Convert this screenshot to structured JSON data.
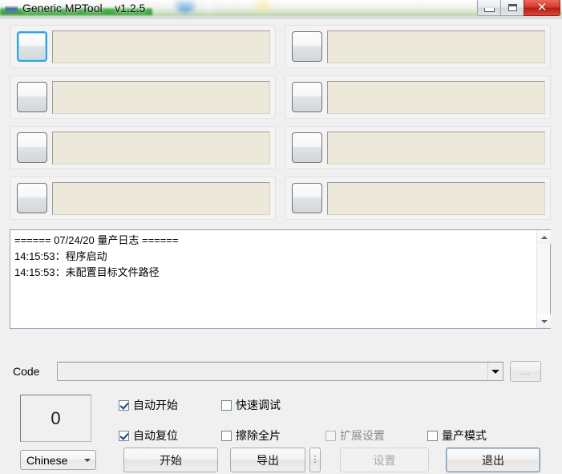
{
  "window": {
    "title": "Generic MPTool    v1.2.5",
    "app_name": "Generic MPTool",
    "version": "v1.2.5",
    "icon": "app-icon",
    "controls": {
      "minimize": "minimize-icon",
      "maximize": "maximize-icon",
      "close": "✕"
    }
  },
  "slots": [
    {
      "id": 1,
      "button_label": "",
      "status_text": "",
      "focused": true
    },
    {
      "id": 2,
      "button_label": "",
      "status_text": "",
      "focused": false
    },
    {
      "id": 3,
      "button_label": "",
      "status_text": "",
      "focused": false
    },
    {
      "id": 4,
      "button_label": "",
      "status_text": "",
      "focused": false
    },
    {
      "id": 5,
      "button_label": "",
      "status_text": "",
      "focused": false
    },
    {
      "id": 6,
      "button_label": "",
      "status_text": "",
      "focused": false
    },
    {
      "id": 7,
      "button_label": "",
      "status_text": "",
      "focused": false
    },
    {
      "id": 8,
      "button_label": "",
      "status_text": "",
      "focused": false
    }
  ],
  "log": {
    "content": "====== 07/24/20 量产日志 ======\n14:15:53：程序启动\n14:15:53：未配置目标文件路径",
    "lines": [
      "====== 07/24/20 量产日志 ======",
      "14:15:53：程序启动",
      "14:15:53：未配置目标文件路径"
    ],
    "scrollbar": {
      "up": "scroll-up-icon",
      "down": "scroll-down-icon"
    }
  },
  "code_row": {
    "label": "Code",
    "value": "",
    "placeholder": "",
    "browse_button": "...",
    "dropdown_icon": "chevron-down-icon"
  },
  "counter": {
    "value": "0"
  },
  "checkboxes": [
    {
      "key": "auto_start",
      "label": "自动开始",
      "checked": true,
      "disabled": false
    },
    {
      "key": "quick_debug",
      "label": "快速调试",
      "checked": false,
      "disabled": false
    },
    {
      "key": "auto_reset",
      "label": "自动复位",
      "checked": true,
      "disabled": false
    },
    {
      "key": "erase_all",
      "label": "擦除全片",
      "checked": false,
      "disabled": false
    },
    {
      "key": "ext_settings",
      "label": "扩展设置",
      "checked": false,
      "disabled": true
    },
    {
      "key": "mp_mode",
      "label": "量产模式",
      "checked": false,
      "disabled": false
    }
  ],
  "bottom_bar": {
    "language": {
      "value": "Chinese",
      "dropdown_icon": "chevron-down-icon"
    },
    "start_button": "开始",
    "export_button": "导出",
    "more_button": "⋮",
    "settings_button": "设置",
    "exit_button": "退出"
  },
  "colors": {
    "window_bg": "#f0f0f0",
    "slot_field_bg": "#ece9da",
    "focus_border": "#33a2dd",
    "close_button": "#d83a2c",
    "log_border": "#8ba6bf"
  }
}
